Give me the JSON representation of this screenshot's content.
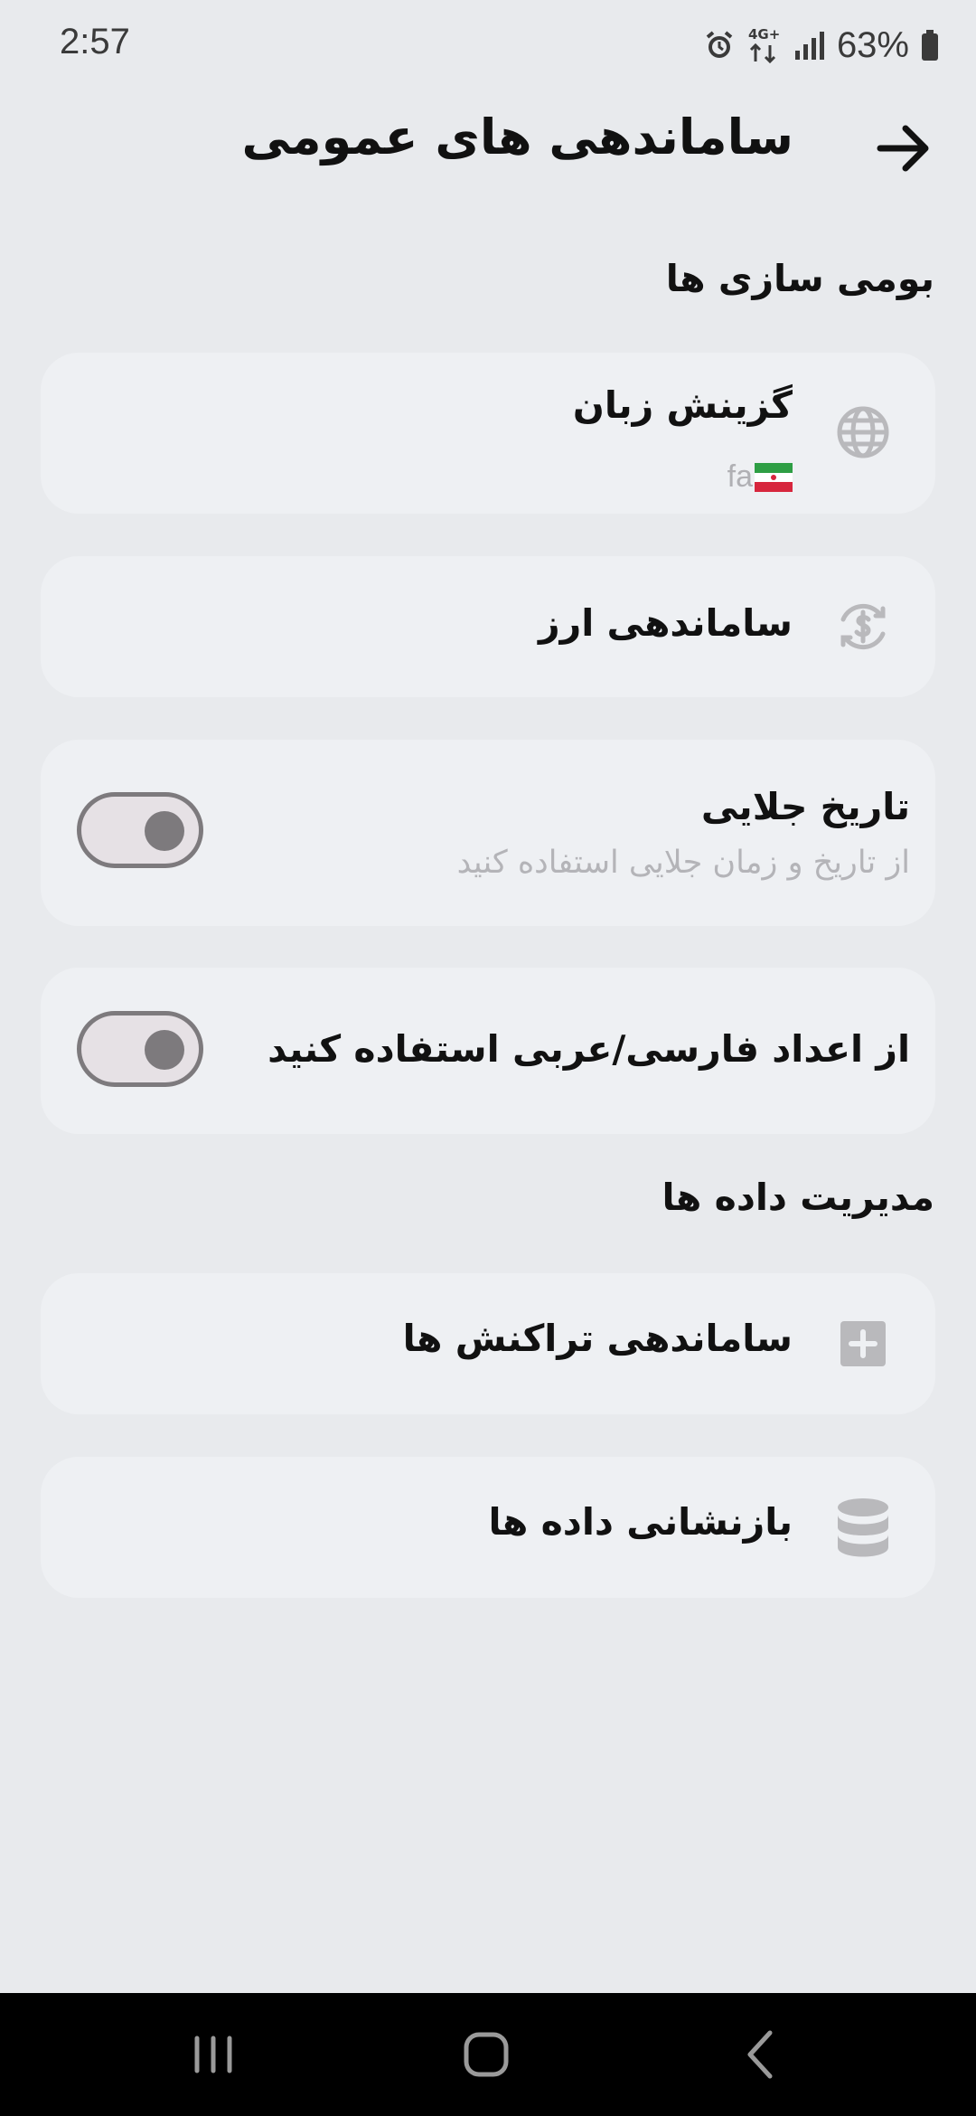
{
  "status_bar": {
    "time": "2:57",
    "battery": "63%",
    "network": "4G+",
    "icons": [
      "alarm-icon",
      "network-4g-icon",
      "signal-icon",
      "battery-icon"
    ]
  },
  "header": {
    "title": "ساماندهی های عمومی",
    "back_icon": "arrow-right-icon"
  },
  "sections": {
    "localization": {
      "heading": "بومی سازی ها",
      "language": {
        "title": "گزینش زبان",
        "value": "fa",
        "icon": "globe-icon",
        "flag": "iran-flag-icon"
      },
      "currency": {
        "title": "ساماندهی ارز",
        "icon": "currency-exchange-icon"
      },
      "jalali": {
        "title": "تاریخ جلایی",
        "subtitle": "از تاریخ و زمان جلایی استفاده کنید",
        "enabled": false
      },
      "numerals": {
        "title": "از اعداد فارسی/عربی استفاده کنید",
        "enabled": false
      }
    },
    "data_management": {
      "heading": "مدیریت داده ها",
      "transactions": {
        "title": "ساماندهی تراکنش ها",
        "icon": "plus-square-icon"
      },
      "reset": {
        "title": "بازنشانی داده ها",
        "icon": "database-icon"
      }
    }
  },
  "colors": {
    "background": "#e8eaed",
    "card": "#eef0f3",
    "icon_gray": "#b9b9bc",
    "toggle_border": "#7d7a7d"
  },
  "nav_bar": {
    "buttons": [
      "recent-apps-icon",
      "home-icon",
      "back-icon"
    ]
  }
}
